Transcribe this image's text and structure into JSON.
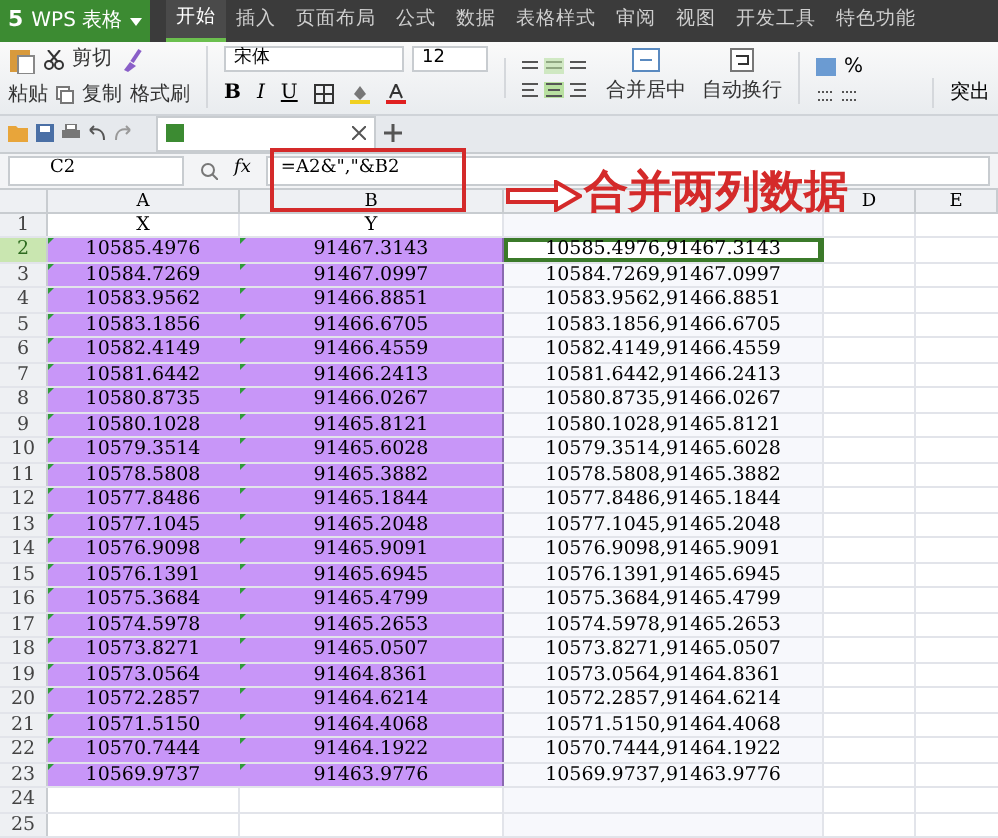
{
  "app_button": {
    "logo": "5",
    "label": "WPS 表格"
  },
  "menu_tabs": [
    {
      "label": "开始",
      "selected": true
    },
    {
      "label": "插入",
      "selected": false
    },
    {
      "label": "页面布局",
      "selected": false
    },
    {
      "label": "公式",
      "selected": false
    },
    {
      "label": "数据",
      "selected": false
    },
    {
      "label": "表格样式",
      "selected": false
    },
    {
      "label": "审阅",
      "selected": false
    },
    {
      "label": "视图",
      "selected": false
    },
    {
      "label": "开发工具",
      "selected": false
    },
    {
      "label": "特色功能",
      "selected": false
    }
  ],
  "ribbon": {
    "paste": "粘贴",
    "cut": "剪切",
    "copy": "复制",
    "format_painter": "格式刷",
    "font": "宋体",
    "font_size": "12",
    "bold": "B",
    "italic": "I",
    "underline": "U",
    "merge": "合并居中",
    "wrap": "自动换行",
    "percent": "%",
    "highlight": "突出"
  },
  "formula_bar": {
    "cell": "C2",
    "fx": "fx",
    "formula": "=A2&\",\"&B2"
  },
  "annotation": "合并两列数据",
  "columns": [
    "A",
    "B",
    null,
    "D",
    "E"
  ],
  "rows": [
    {
      "number": "1",
      "a": "X",
      "b": "Y",
      "c": "",
      "filled": false,
      "selected": false
    },
    {
      "number": "2",
      "a": "10585.4976",
      "b": "91467.3143",
      "c": "10585.4976,91467.3143",
      "filled": true,
      "selected": true
    },
    {
      "number": "3",
      "a": "10584.7269",
      "b": "91467.0997",
      "c": "10584.7269,91467.0997",
      "filled": true,
      "selected": false
    },
    {
      "number": "4",
      "a": "10583.9562",
      "b": "91466.8851",
      "c": "10583.9562,91466.8851",
      "filled": true,
      "selected": false
    },
    {
      "number": "5",
      "a": "10583.1856",
      "b": "91466.6705",
      "c": "10583.1856,91466.6705",
      "filled": true,
      "selected": false
    },
    {
      "number": "6",
      "a": "10582.4149",
      "b": "91466.4559",
      "c": "10582.4149,91466.4559",
      "filled": true,
      "selected": false
    },
    {
      "number": "7",
      "a": "10581.6442",
      "b": "91466.2413",
      "c": "10581.6442,91466.2413",
      "filled": true,
      "selected": false
    },
    {
      "number": "8",
      "a": "10580.8735",
      "b": "91466.0267",
      "c": "10580.8735,91466.0267",
      "filled": true,
      "selected": false
    },
    {
      "number": "9",
      "a": "10580.1028",
      "b": "91465.8121",
      "c": "10580.1028,91465.8121",
      "filled": true,
      "selected": false
    },
    {
      "number": "10",
      "a": "10579.3514",
      "b": "91465.6028",
      "c": "10579.3514,91465.6028",
      "filled": true,
      "selected": false
    },
    {
      "number": "11",
      "a": "10578.5808",
      "b": "91465.3882",
      "c": "10578.5808,91465.3882",
      "filled": true,
      "selected": false
    },
    {
      "number": "12",
      "a": "10577.8486",
      "b": "91465.1844",
      "c": "10577.8486,91465.1844",
      "filled": true,
      "selected": false
    },
    {
      "number": "13",
      "a": "10577.1045",
      "b": "91465.2048",
      "c": "10577.1045,91465.2048",
      "filled": true,
      "selected": false
    },
    {
      "number": "14",
      "a": "10576.9098",
      "b": "91465.9091",
      "c": "10576.9098,91465.9091",
      "filled": true,
      "selected": false
    },
    {
      "number": "15",
      "a": "10576.1391",
      "b": "91465.6945",
      "c": "10576.1391,91465.6945",
      "filled": true,
      "selected": false
    },
    {
      "number": "16",
      "a": "10575.3684",
      "b": "91465.4799",
      "c": "10575.3684,91465.4799",
      "filled": true,
      "selected": false
    },
    {
      "number": "17",
      "a": "10574.5978",
      "b": "91465.2653",
      "c": "10574.5978,91465.2653",
      "filled": true,
      "selected": false
    },
    {
      "number": "18",
      "a": "10573.8271",
      "b": "91465.0507",
      "c": "10573.8271,91465.0507",
      "filled": true,
      "selected": false
    },
    {
      "number": "19",
      "a": "10573.0564",
      "b": "91464.8361",
      "c": "10573.0564,91464.8361",
      "filled": true,
      "selected": false
    },
    {
      "number": "20",
      "a": "10572.2857",
      "b": "91464.6214",
      "c": "10572.2857,91464.6214",
      "filled": true,
      "selected": false
    },
    {
      "number": "21",
      "a": "10571.5150",
      "b": "91464.4068",
      "c": "10571.5150,91464.4068",
      "filled": true,
      "selected": false
    },
    {
      "number": "22",
      "a": "10570.7444",
      "b": "91464.1922",
      "c": "10570.7444,91464.1922",
      "filled": true,
      "selected": false
    },
    {
      "number": "23",
      "a": "10569.9737",
      "b": "91463.9776",
      "c": "10569.9737,91463.9776",
      "filled": true,
      "selected": false
    },
    {
      "number": "24",
      "a": "",
      "b": "",
      "c": "",
      "filled": false,
      "selected": false
    },
    {
      "number": "25",
      "a": "",
      "b": "",
      "c": "",
      "filled": false,
      "selected": false
    }
  ]
}
